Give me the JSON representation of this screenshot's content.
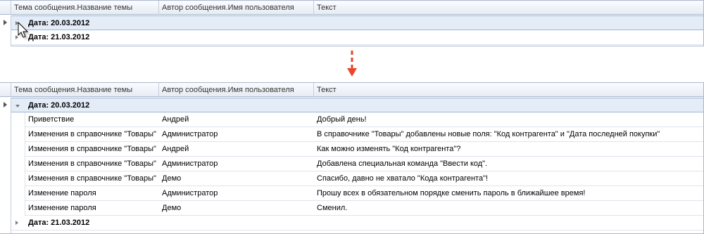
{
  "columns": [
    "Тема сообщения.Название темы",
    "Автор сообщения.Имя пользователя",
    "Текст"
  ],
  "top": {
    "groups": [
      "Дата: 20.03.2012",
      "Дата: 21.03.2012"
    ]
  },
  "bottom": {
    "group1": "Дата: 20.03.2012",
    "group2": "Дата: 21.03.2012",
    "rows": [
      {
        "topic": "Приветствие",
        "author": "Андрей",
        "text": "Добрый день!"
      },
      {
        "topic": "Изменения в справочнике \"Товары\"",
        "author": "Администратор",
        "text": "В справочнике \"Товары\" добавлены новые поля: \"Код контрагента\" и \"Дата последней покупки\""
      },
      {
        "topic": "Изменения в справочнике \"Товары\"",
        "author": "Андрей",
        "text": "Как можно изменять \"Код контрагента\"?"
      },
      {
        "topic": "Изменения в справочнике \"Товары\"",
        "author": "Администратор",
        "text": "Добавлена специальная команда \"Ввести код\"."
      },
      {
        "topic": "Изменения в справочнике \"Товары\"",
        "author": "Демо",
        "text": "Спасибо, давно не хватало \"Кода контрагента\"!"
      },
      {
        "topic": "Изменение пароля",
        "author": "Администратор",
        "text": "Прошу всех в обязательном порядке сменить пароль в ближайшее время!"
      },
      {
        "topic": "Изменение пароля",
        "author": "Демо",
        "text": "Сменил."
      }
    ]
  },
  "colors": {
    "arrow": "#e8472b",
    "header_bg": "#e6ecf4",
    "selected_row": "#e3ecf7"
  }
}
